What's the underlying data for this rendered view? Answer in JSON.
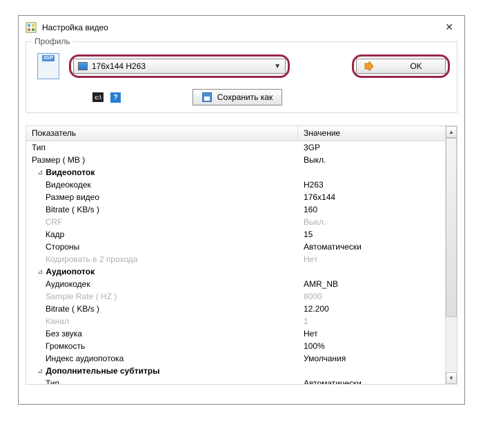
{
  "window": {
    "title": "Настройка видео",
    "close": "✕"
  },
  "profile": {
    "legend": "Профиль",
    "file_badge": "3GP",
    "combo_value": "176x144 H263",
    "ok_label": "OK",
    "cmd_text": "c:\\",
    "help_text": "?",
    "save_label": "Сохранить как"
  },
  "table": {
    "hdr_key": "Показатель",
    "hdr_val": "Значение",
    "rows": [
      {
        "k": "Тип",
        "v": "3GP",
        "style": "indent0"
      },
      {
        "k": "Размер ( MB )",
        "v": "Выкл.",
        "style": "indent0"
      },
      {
        "k": "Видеопоток",
        "v": "",
        "style": "group"
      },
      {
        "k": "Видеокодек",
        "v": "H263",
        "style": "indent1"
      },
      {
        "k": "Размер видео",
        "v": "176x144",
        "style": "indent1"
      },
      {
        "k": "Bitrate ( KB/s )",
        "v": "160",
        "style": "indent1"
      },
      {
        "k": "CRF",
        "v": "Выкл.",
        "style": "indent1",
        "disabled": true
      },
      {
        "k": "Кадр",
        "v": "15",
        "style": "indent1"
      },
      {
        "k": "Стороны",
        "v": "Автоматически",
        "style": "indent1"
      },
      {
        "k": "Кодировать в 2 прохода",
        "v": "Нет",
        "style": "indent1",
        "disabled": true
      },
      {
        "k": "Аудиопоток",
        "v": "",
        "style": "group"
      },
      {
        "k": "Аудиокодек",
        "v": "AMR_NB",
        "style": "indent1"
      },
      {
        "k": "Sample Rate ( HZ )",
        "v": "8000",
        "style": "indent1",
        "disabled": true
      },
      {
        "k": "Bitrate ( KB/s )",
        "v": "12.200",
        "style": "indent1"
      },
      {
        "k": "Канал",
        "v": "1",
        "style": "indent1",
        "disabled": true
      },
      {
        "k": "Без звука",
        "v": "Нет",
        "style": "indent1"
      },
      {
        "k": "Громкость",
        "v": "100%",
        "style": "indent1"
      },
      {
        "k": "Индекс аудиопотока",
        "v": "Умолчания",
        "style": "indent1"
      },
      {
        "k": "Дополнительные субтитры",
        "v": "",
        "style": "group"
      },
      {
        "k": "Тип",
        "v": "Автоматически",
        "style": "indent1"
      }
    ],
    "twisty": "⊿"
  }
}
